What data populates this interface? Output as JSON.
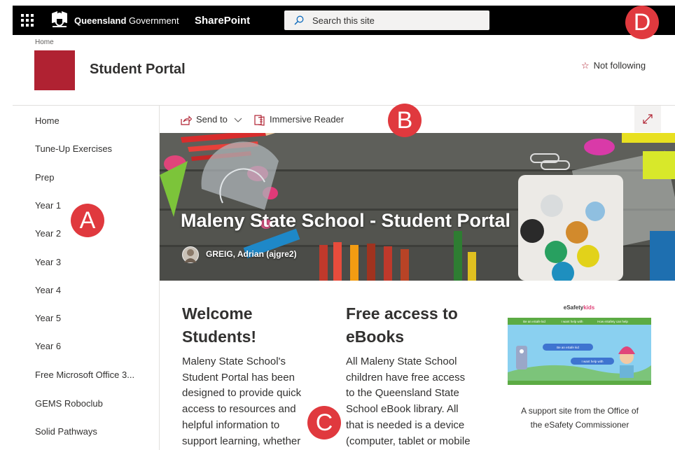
{
  "suite_bar": {
    "org_name_bold": "Queensland",
    "org_name_rest": " Government",
    "app_name": "SharePoint",
    "search_placeholder": "Search this site"
  },
  "markers": {
    "a": "A",
    "b": "B",
    "c": "C",
    "d": "D"
  },
  "site": {
    "breadcrumb": "Home",
    "title": "Student Portal",
    "follow_label": "Not following"
  },
  "nav": {
    "items": [
      "Home",
      "Tune-Up Exercises",
      "Prep",
      "Year 1",
      "Year 2",
      "Year 3",
      "Year 4",
      "Year 5",
      "Year 6",
      "Free Microsoft Office 3...",
      "GEMS Roboclub",
      "Solid Pathways"
    ]
  },
  "command_bar": {
    "send_to": "Send to",
    "immersive_reader": "Immersive Reader"
  },
  "hero": {
    "title": "Maleny State School - Student Portal",
    "author": "GREIG, Adrian (ajgre2)"
  },
  "welcome": {
    "title_lines": [
      "Welcome",
      "Students!"
    ],
    "body_lines": [
      "Maleny State School's",
      "Student Portal has been",
      "designed to provide quick",
      "access to resources and",
      "helpful information to",
      "support learning, whether"
    ]
  },
  "ebooks": {
    "title_lines": [
      "Free access to",
      "eBooks"
    ],
    "body_lines": [
      "All Maleny State School",
      "children have free access",
      "to the Queensland State",
      "School eBook library. All",
      "that is needed is a device",
      "(computer, tablet or mobile"
    ]
  },
  "esafety": {
    "logo_main": "eSafety",
    "logo_kids": "kids",
    "tabs": [
      "Be an eSafe kid",
      "I want help with",
      "How eSafety can help"
    ],
    "btn_1": "Be an eSafe kid",
    "btn_2": "I want help with",
    "caption_lines": [
      "A support site from the Office of",
      "the eSafety Commissioner"
    ]
  },
  "colors": {
    "suite_bar": "#000000",
    "accent": "#b02232",
    "marker": "#e0393e"
  }
}
